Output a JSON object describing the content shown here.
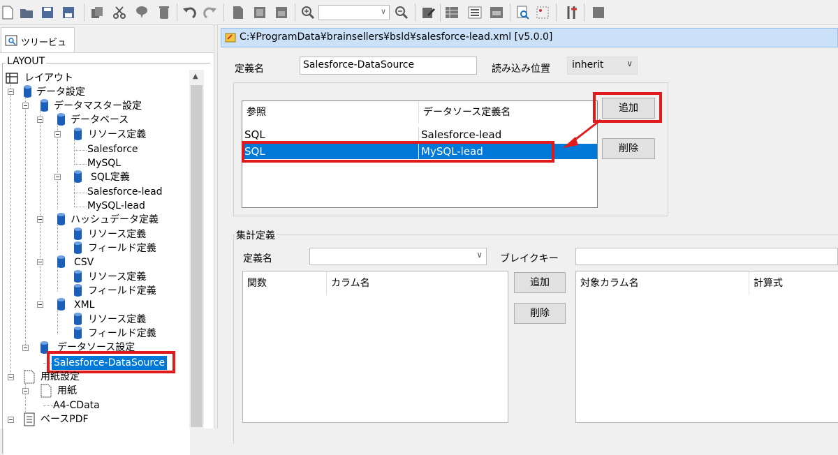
{
  "toolbar": {
    "zoom_value": "",
    "icons": [
      "new-file-icon",
      "open-folder-icon",
      "save-icon",
      "save-all-icon",
      "copy-icon",
      "cut-icon",
      "paste-icon",
      "delete-icon",
      "undo-icon",
      "redo-icon",
      "page-icon",
      "page2-icon",
      "page3-icon",
      "zoom-in-icon",
      "zoom-out-icon",
      "edit-icon",
      "table-icon",
      "list-icon",
      "form-icon",
      "preview-icon",
      "grid-icon",
      "tools-icon",
      "stop-icon"
    ]
  },
  "left": {
    "tab_label": "ツリービュー",
    "group_title": "LAYOUT",
    "tree": [
      {
        "label": "レイアウト"
      },
      {
        "label": "データ設定"
      },
      {
        "label": "データマスター設定"
      },
      {
        "label": "データベース"
      },
      {
        "label": "リソース定義"
      },
      {
        "label": "Salesforce"
      },
      {
        "label": "MySQL"
      },
      {
        "label": "SQL定義"
      },
      {
        "label": "Salesforce-lead"
      },
      {
        "label": "MySQL-lead"
      },
      {
        "label": "ハッシュデータ定義"
      },
      {
        "label": "リソース定義"
      },
      {
        "label": "フィールド定義"
      },
      {
        "label": "CSV"
      },
      {
        "label": "リソース定義"
      },
      {
        "label": "フィールド定義"
      },
      {
        "label": "XML"
      },
      {
        "label": "リソース定義"
      },
      {
        "label": "フィールド定義"
      },
      {
        "label": "データソース設定"
      },
      {
        "label": "Salesforce-DataSource"
      },
      {
        "label": "用紙設定"
      },
      {
        "label": "用紙"
      },
      {
        "label": "A4-CData"
      },
      {
        "label": "ベースPDF"
      }
    ]
  },
  "right": {
    "title": "C:¥ProgramData¥brainsellers¥bsld¥salesforce-lead.xml [v5.0.0]",
    "def_name_label": "定義名",
    "def_name_value": "Salesforce-DataSource",
    "read_pos_label": "読み込み位置",
    "read_pos_value": "inherit",
    "ref_table": {
      "headers": [
        "参照",
        "データソース定義名"
      ],
      "rows": [
        [
          "SQL",
          "Salesforce-lead"
        ],
        [
          "SQL",
          "MySQL-lead"
        ]
      ],
      "selected_row": 1
    },
    "add_label": "追加",
    "delete_label": "削除",
    "agg": {
      "group_title": "集計定義",
      "def_name_label": "定義名",
      "def_name_value": "",
      "break_key_label": "ブレイクキー",
      "break_key_value": "",
      "func_headers": [
        "関数",
        "カラム名"
      ],
      "add_label": "追加",
      "delete_label": "削除",
      "target_headers": [
        "対象カラム名",
        "計算式"
      ]
    }
  },
  "colors": {
    "selection": "#0078d7",
    "highlight_box": "#e11b1b",
    "titlebar": "#cbe1f7"
  }
}
